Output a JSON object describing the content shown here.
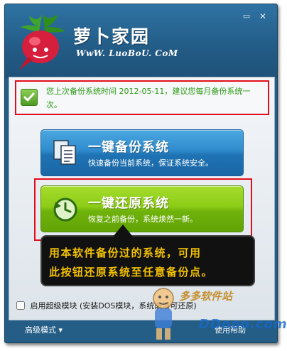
{
  "brand": {
    "title": "萝卜家园",
    "url": "WwW. LuoBoU. CoM",
    "logo_icon": "radish-icon"
  },
  "window_controls": {
    "minimize_glyph": "▭",
    "close_glyph": "✕"
  },
  "notice": {
    "icon": "checkmark-icon",
    "text": "您上次备份系统时间 2012-05-11，建议您每月备份系统一次。"
  },
  "backup_button": {
    "icon": "document-copy-icon",
    "title": "一键备份系统",
    "subtitle": "快速备份当前系统，保证系统安全。",
    "color": "#2f8bcc"
  },
  "restore_button": {
    "icon": "restore-clock-icon",
    "title": "一键还原系统",
    "subtitle": "恢复之前备份，系统焕然一新。",
    "color": "#8ccc17"
  },
  "tooltip": {
    "line1": "用本软件备份过的系统，可用",
    "line2": "此按钮还原系统至任意备份点。",
    "color": "#f2c100"
  },
  "super_mode": {
    "checked": false,
    "label": "启用超级模块 (安装DOS模块，系统崩溃可还原)"
  },
  "footer": {
    "advanced_label": "高级模式 ▾",
    "help_label": "使用帮助"
  },
  "watermark": {
    "site_name": "多多软件站",
    "url": "DDooo.com"
  },
  "colors": {
    "frame": "#245d86",
    "highlight_border": "#e30e1b",
    "notice_text": "#2b9a13"
  }
}
